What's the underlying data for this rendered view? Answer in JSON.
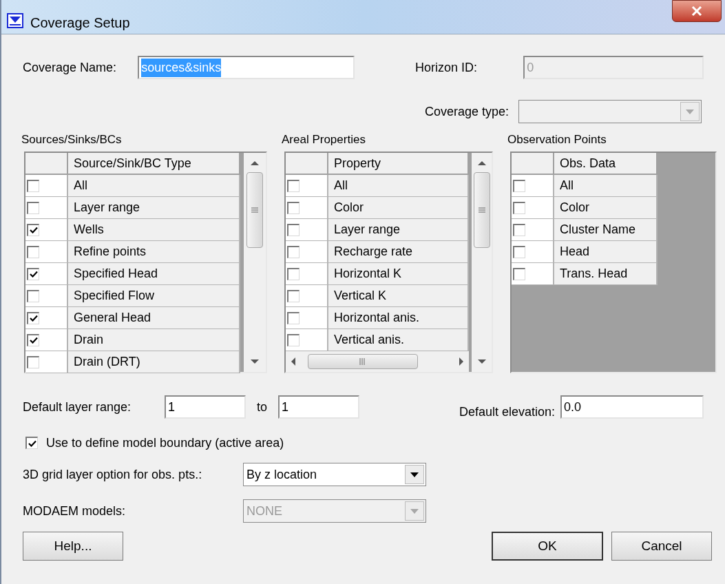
{
  "window": {
    "title": "Coverage Setup"
  },
  "coverage_name": {
    "label": "Coverage Name:",
    "value": "sources&sinks",
    "text_selected": true
  },
  "horizon_id": {
    "label": "Horizon ID:",
    "value": "0",
    "disabled": true
  },
  "coverage_type": {
    "label": "Coverage type:",
    "disabled": true
  },
  "sources_sinks": {
    "title": "Sources/Sinks/BCs",
    "column": "Source/Sink/BC Type",
    "rows": [
      {
        "label": "All",
        "checked": false
      },
      {
        "label": "Layer range",
        "checked": false
      },
      {
        "label": "Wells",
        "checked": true
      },
      {
        "label": "Refine points",
        "checked": false
      },
      {
        "label": "Specified Head",
        "checked": true
      },
      {
        "label": "Specified Flow",
        "checked": false
      },
      {
        "label": "General Head",
        "checked": true
      },
      {
        "label": "Drain",
        "checked": true
      },
      {
        "label": "Drain (DRT)",
        "checked": false
      }
    ]
  },
  "areal_properties": {
    "title": "Areal Properties",
    "column": "Property",
    "rows": [
      {
        "label": "All",
        "checked": false
      },
      {
        "label": "Color",
        "checked": false
      },
      {
        "label": "Layer range",
        "checked": false
      },
      {
        "label": "Recharge rate",
        "checked": false
      },
      {
        "label": "Horizontal K",
        "checked": false
      },
      {
        "label": "Vertical K",
        "checked": false
      },
      {
        "label": "Horizontal anis.",
        "checked": false
      },
      {
        "label": "Vertical anis.",
        "checked": false
      }
    ]
  },
  "observation_points": {
    "title": "Observation Points",
    "column": "Obs. Data",
    "rows": [
      {
        "label": "All",
        "checked": false
      },
      {
        "label": "Color",
        "checked": false
      },
      {
        "label": "Cluster Name",
        "checked": false
      },
      {
        "label": "Head",
        "checked": false
      },
      {
        "label": "Trans. Head",
        "checked": false
      }
    ]
  },
  "default_layer_range": {
    "label": "Default layer range:",
    "from": "1",
    "separator": "to",
    "to": "1"
  },
  "default_elevation": {
    "label": "Default elevation:",
    "value": "0.0"
  },
  "model_boundary": {
    "label": "Use to define model boundary (active area)",
    "checked": true
  },
  "grid_layer_option": {
    "label": "3D grid layer option for obs. pts.:",
    "value": "By z location",
    "disabled": false
  },
  "modaem_models": {
    "label": "MODAEM models:",
    "value": "NONE",
    "disabled": true
  },
  "buttons": [
    {
      "label": "Help...",
      "default": false
    },
    {
      "label": "OK",
      "default": true
    },
    {
      "label": "Cancel",
      "default": false
    }
  ]
}
